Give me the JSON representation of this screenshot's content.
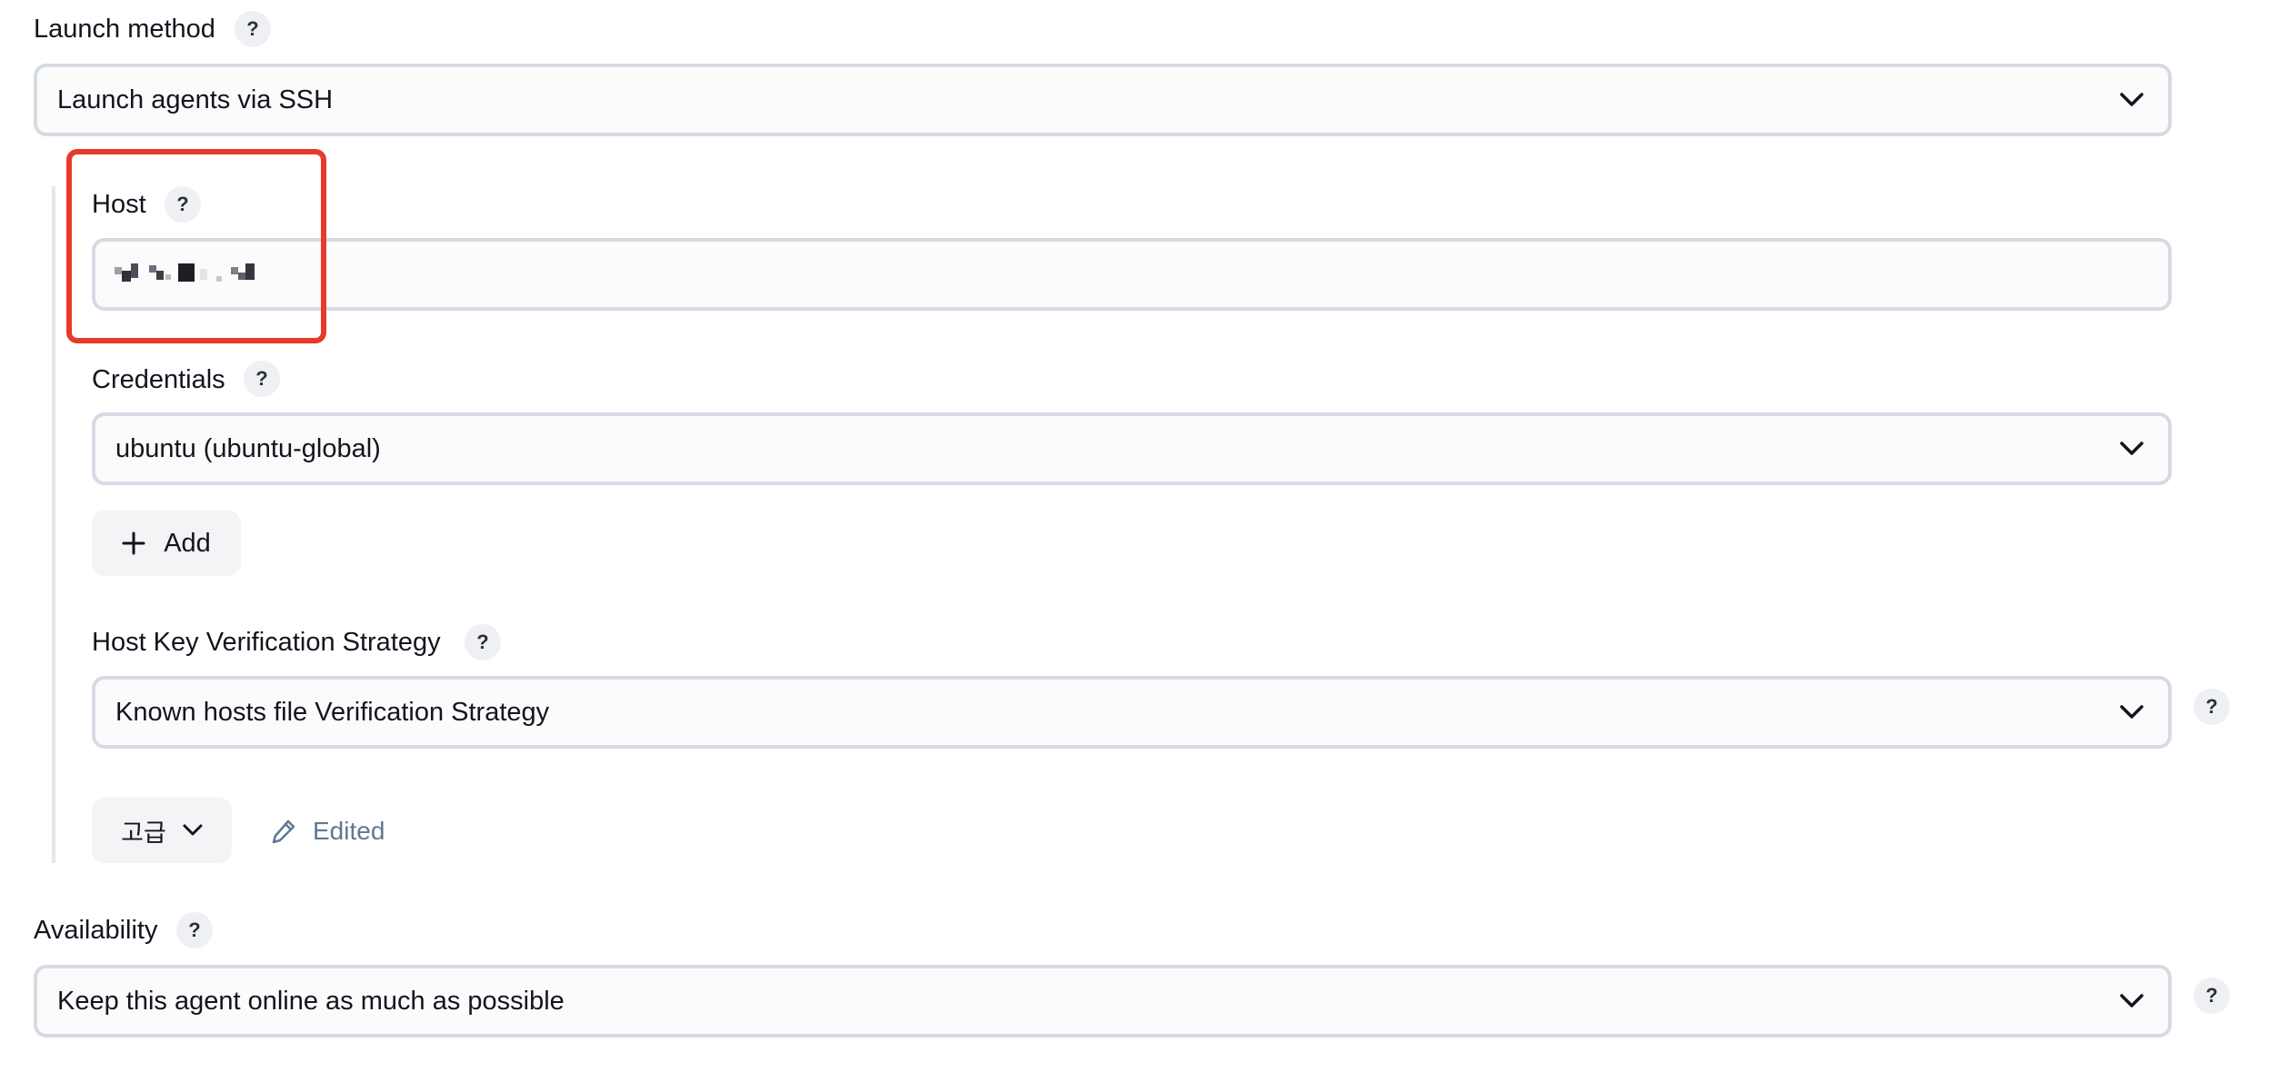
{
  "launch_method": {
    "label": "Launch method",
    "help": "?",
    "selected": "Launch agents via SSH"
  },
  "host": {
    "label": "Host",
    "help": "?",
    "value": ""
  },
  "credentials": {
    "label": "Credentials",
    "help": "?",
    "selected": "ubuntu (ubuntu-global)",
    "add_label": "Add"
  },
  "host_key": {
    "label": "Host Key Verification Strategy",
    "help": "?",
    "selected": "Known hosts file Verification Strategy",
    "side_help": "?"
  },
  "advanced": {
    "label": "고급",
    "edited_label": "Edited"
  },
  "availability": {
    "label": "Availability",
    "help": "?",
    "selected": "Keep this agent online as much as possible",
    "side_help": "?"
  },
  "colors": {
    "highlight": "#e8392b",
    "edited_text": "#5f7892",
    "field_border": "#d5dbe3"
  },
  "icons": [
    "chevron-down-icon",
    "plus-icon",
    "pencil-icon",
    "question-icon"
  ]
}
